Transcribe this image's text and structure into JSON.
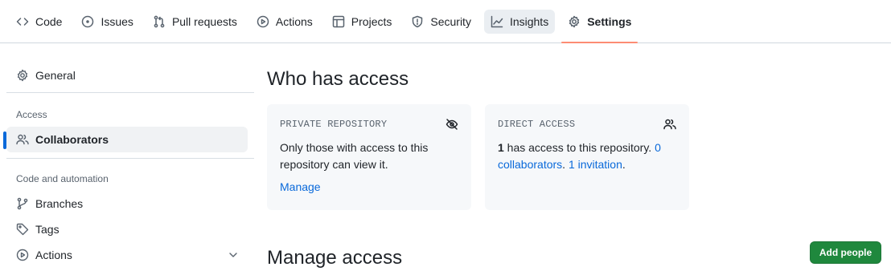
{
  "repo_nav": {
    "tabs": [
      {
        "label": "Code",
        "icon": "code-icon"
      },
      {
        "label": "Issues",
        "icon": "issue-opened-icon"
      },
      {
        "label": "Pull requests",
        "icon": "git-pull-request-icon"
      },
      {
        "label": "Actions",
        "icon": "play-icon"
      },
      {
        "label": "Projects",
        "icon": "table-icon"
      },
      {
        "label": "Security",
        "icon": "shield-icon"
      },
      {
        "label": "Insights",
        "icon": "graph-icon"
      },
      {
        "label": "Settings",
        "icon": "gear-icon"
      }
    ],
    "selected": "Settings",
    "hovered": "Insights",
    "accent_color": "#fd8c73"
  },
  "sidebar": {
    "general_label": "General",
    "access_heading": "Access",
    "collaborators_label": "Collaborators",
    "code_automation_heading": "Code and automation",
    "branches_label": "Branches",
    "tags_label": "Tags",
    "actions_label": "Actions",
    "active_item": "Collaborators",
    "active_color": "#0969da"
  },
  "who_has_access": {
    "title": "Who has access",
    "private_card": {
      "title": "PRIVATE REPOSITORY",
      "icon": "eye-closed-icon",
      "text": "Only those with access to this repository can view it.",
      "link": "Manage"
    },
    "direct_card": {
      "title": "DIRECT ACCESS",
      "icon": "people-icon",
      "count": "1",
      "text_after_count": " has access to this repository.",
      "collaborators_link": "0 collaborators",
      "separator": ".",
      "invitation_link": "1 invitation",
      "end": "."
    }
  },
  "manage_access": {
    "title": "Manage access",
    "add_people_label": "Add people",
    "button_color": "#1f883d"
  }
}
